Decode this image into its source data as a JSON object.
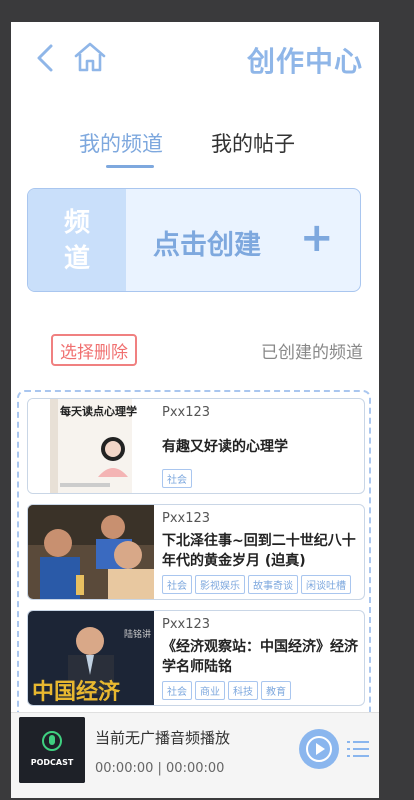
{
  "header": {
    "title": "创作中心"
  },
  "tabs": [
    {
      "label": "我的频道",
      "active": true
    },
    {
      "label": "我的帖子",
      "active": false
    }
  ],
  "create": {
    "left_top": "频",
    "left_bottom": "道",
    "label": "点击创建",
    "plus": "+"
  },
  "manage": {
    "delete_label": "选择删除",
    "created_label": "已创建的频道"
  },
  "channels": [
    {
      "user": "Pxx123",
      "title": "有趣又好读的心理学",
      "tags": [
        "社会"
      ],
      "cover_text": "每天读点心理学"
    },
    {
      "user": "Pxx123",
      "title": "下北泽往事~回到二十世纪八十年代的黄金岁月 (迫真)",
      "tags": [
        "社会",
        "影视娱乐",
        "故事奇谈",
        "闲谈吐槽"
      ]
    },
    {
      "user": "Pxx123",
      "title": "《经济观察站：中国经济》经济学名师陆铭",
      "tags": [
        "社会",
        "商业",
        "科技",
        "教育"
      ],
      "cover_text": "中国经济",
      "cover_side": "陆铭讲"
    }
  ],
  "player": {
    "now_playing": "当前无广播音频播放",
    "time": "00:00:00 | 00:00:00",
    "cover_text": "PODCAST"
  },
  "colors": {
    "accent": "#7ea8de",
    "accent_light": "#eaf3ff",
    "danger": "#f07070",
    "background": "#3a3a3c"
  }
}
